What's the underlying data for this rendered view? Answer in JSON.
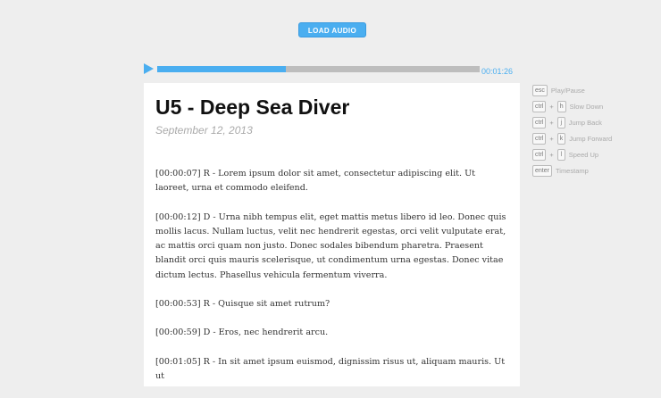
{
  "toolbar": {
    "load_label": "LOAD AUDIO"
  },
  "player": {
    "time": "00:01:26",
    "progress": 0.4
  },
  "document": {
    "title": "U5 - Deep Sea Diver",
    "date": "September 12, 2013",
    "paragraphs": [
      "[00:00:07]  R - Lorem ipsum dolor sit amet, consectetur adipiscing elit. Ut laoreet, urna et commodo eleifend.",
      "[00:00:12] D - Urna nibh tempus elit, eget mattis metus libero id leo. Donec quis mollis lacus. Nullam luctus, velit nec hendrerit egestas, orci velit vulputate erat, ac mattis orci quam non justo. Donec sodales bibendum pharetra. Praesent blandit orci quis mauris scelerisque, ut condimentum urna egestas. Donec vitae dictum lectus. Phasellus vehicula fermentum viverra.",
      "[00:00:53] R - Quisque sit amet rutrum?",
      "[00:00:59]  D - Eros, nec hendrerit arcu.",
      "[00:01:05] R - In sit amet ipsum euismod, dignissim risus ut, aliquam mauris. Ut ut"
    ]
  },
  "shortcuts": [
    {
      "keys": [
        "esc"
      ],
      "label": "Play/Pause"
    },
    {
      "keys": [
        "ctrl",
        "h"
      ],
      "label": "Slow Down"
    },
    {
      "keys": [
        "ctrl",
        "j"
      ],
      "label": "Jump Back"
    },
    {
      "keys": [
        "ctrl",
        "k"
      ],
      "label": "Jump Forward"
    },
    {
      "keys": [
        "ctrl",
        "l"
      ],
      "label": "Speed Up"
    },
    {
      "keys": [
        "enter"
      ],
      "label": "Timestamp"
    }
  ],
  "colors": {
    "accent": "#4aaef0",
    "track": "#bdbdbd",
    "background": "#eeeeee"
  }
}
